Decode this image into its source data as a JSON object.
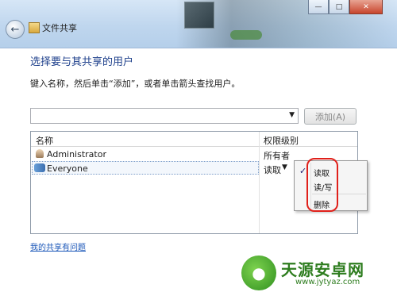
{
  "window": {
    "title": "文件共享",
    "controls": {
      "minimize": "—",
      "maximize": "□",
      "close": "✕"
    },
    "back_icon": "back-arrow-icon"
  },
  "main": {
    "heading": "选择要与其共享的用户",
    "instruction": "键入名称，然后单击“添加”，或者单击箭头查找用户。",
    "combo_value": "",
    "add_button": "添加(A)"
  },
  "table": {
    "headers": {
      "name": "名称",
      "permission": "权限级别"
    },
    "rows": [
      {
        "name": "Administrator",
        "permission": "所有者",
        "icon": "user-icon"
      },
      {
        "name": "Everyone",
        "permission": "读取",
        "icon": "group-icon"
      }
    ]
  },
  "context_menu": {
    "items": [
      {
        "label": "读取",
        "checked": true
      },
      {
        "label": "读/写",
        "checked": false
      },
      {
        "label": "删除",
        "checked": false
      }
    ],
    "check_mark": "✓",
    "highlight_color": "#e0201a"
  },
  "help_link": "我的共享有问题",
  "watermark": {
    "title": "天源安卓网",
    "url": "www.jytyaz.com"
  }
}
